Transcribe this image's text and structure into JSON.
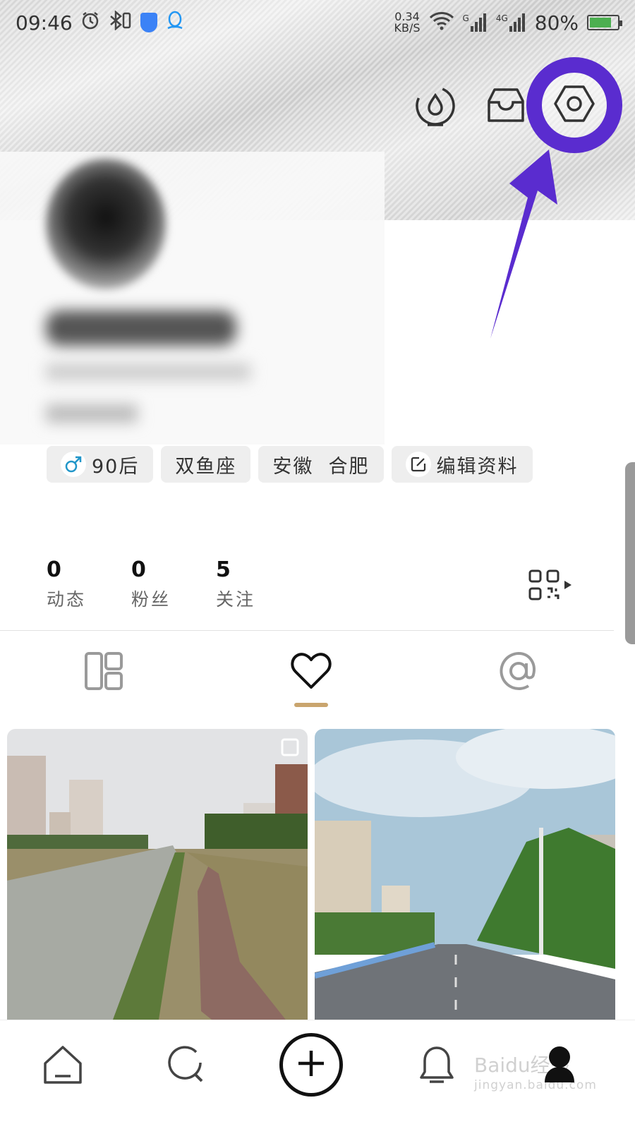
{
  "status_bar": {
    "time": "09:46",
    "net_speed_value": "0.34",
    "net_speed_unit": "KB/S",
    "signal_1_label": "G",
    "signal_2_label": "4G",
    "battery_percent": "80%",
    "battery_level": 0.8
  },
  "profile": {
    "tags": [
      {
        "label": "90后",
        "icon": "male-icon"
      },
      {
        "label": "双鱼座"
      },
      {
        "label": "安徽  合肥"
      },
      {
        "label": "编辑资料",
        "icon": "edit-icon"
      }
    ]
  },
  "stats": [
    {
      "value": "0",
      "label": "动态"
    },
    {
      "value": "0",
      "label": "粉丝"
    },
    {
      "value": "5",
      "label": "关注"
    }
  ],
  "tabs": [
    "grid-layout-icon",
    "heart-icon",
    "at-icon"
  ],
  "active_tab": 1,
  "watermark": {
    "main": "Baidu经验",
    "sub": "jingyan.baidu.com"
  },
  "colors": {
    "highlight": "#5a2ccf",
    "tab_underline": "#c9a56e"
  }
}
